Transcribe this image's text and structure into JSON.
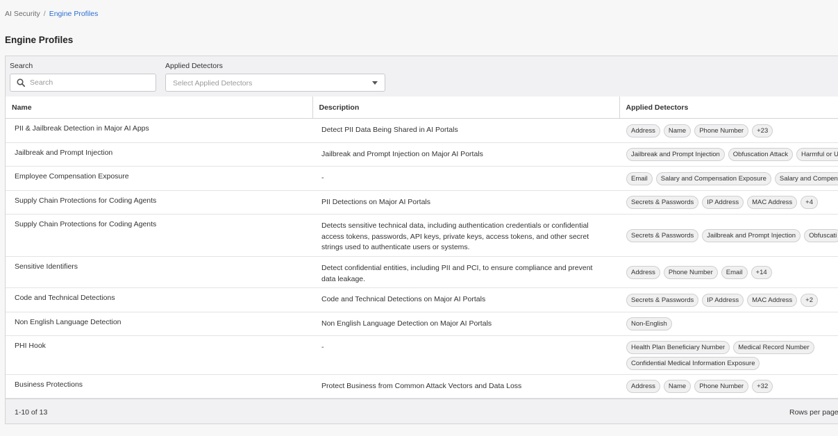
{
  "breadcrumb": {
    "parent": "AI Security",
    "separator": "/",
    "current": "Engine Profiles"
  },
  "page_title": "Engine Profiles",
  "filters": {
    "search": {
      "label": "Search",
      "placeholder": "Search",
      "value": ""
    },
    "applied_detectors": {
      "label": "Applied Detectors",
      "placeholder": "Select Applied Detectors"
    }
  },
  "table": {
    "columns": [
      "Name",
      "Description",
      "Applied Detectors"
    ],
    "rows": [
      {
        "name": "PII & Jailbreak Detection in Major AI Apps",
        "description": "Detect PII Data Being Shared in AI Portals",
        "detectors": [
          "Address",
          "Name",
          "Phone Number",
          "+23"
        ]
      },
      {
        "name": "Jailbreak and Prompt Injection",
        "description": "Jailbreak and Prompt Injection on Major AI Portals",
        "detectors": [
          "Jailbreak and Prompt Injection",
          "Obfuscation Attack",
          "Harmful or U"
        ]
      },
      {
        "name": "Employee Compensation Exposure",
        "description": "-",
        "detectors": [
          "Email",
          "Salary and Compensation Exposure",
          "Salary and Compens"
        ]
      },
      {
        "name": "Supply Chain Protections for Coding Agents",
        "description": "PII Detections on Major AI Portals",
        "detectors": [
          "Secrets & Passwords",
          "IP Address",
          "MAC Address",
          "+4"
        ]
      },
      {
        "name": "Supply Chain Protections for Coding Agents",
        "description": "Detects sensitive technical data, including authentication credentials or confidential access tokens, passwords, API keys, private keys, access tokens, and other secret strings used to authenticate users or systems.",
        "detectors": [
          "Secrets & Passwords",
          "Jailbreak and Prompt Injection",
          "Obfuscati"
        ]
      },
      {
        "name": "Sensitive Identifiers",
        "description": "Detect confidential entities, including PII and PCI, to ensure compliance and prevent data leakage.",
        "detectors": [
          "Address",
          "Phone Number",
          "Email",
          "+14"
        ]
      },
      {
        "name": "Code and Technical Detections",
        "description": "Code and Technical Detections on Major AI Portals",
        "detectors": [
          "Secrets & Passwords",
          "IP Address",
          "MAC Address",
          "+2"
        ]
      },
      {
        "name": "Non English Language Detection",
        "description": "Non English Language Detection on Major AI Portals",
        "detectors": [
          "Non-English"
        ]
      },
      {
        "name": "PHI Hook",
        "description": "-",
        "detectors": [
          "Health Plan Beneficiary Number",
          "Medical Record Number",
          "Confidential Medical Information Exposure"
        ]
      },
      {
        "name": "Business Protections",
        "description": "Protect Business from Common Attack Vectors and Data Loss",
        "detectors": [
          "Address",
          "Name",
          "Phone Number",
          "+32"
        ]
      }
    ]
  },
  "pagination": {
    "range": "1-10 of 13",
    "rows_per_page_label": "Rows per page:"
  }
}
